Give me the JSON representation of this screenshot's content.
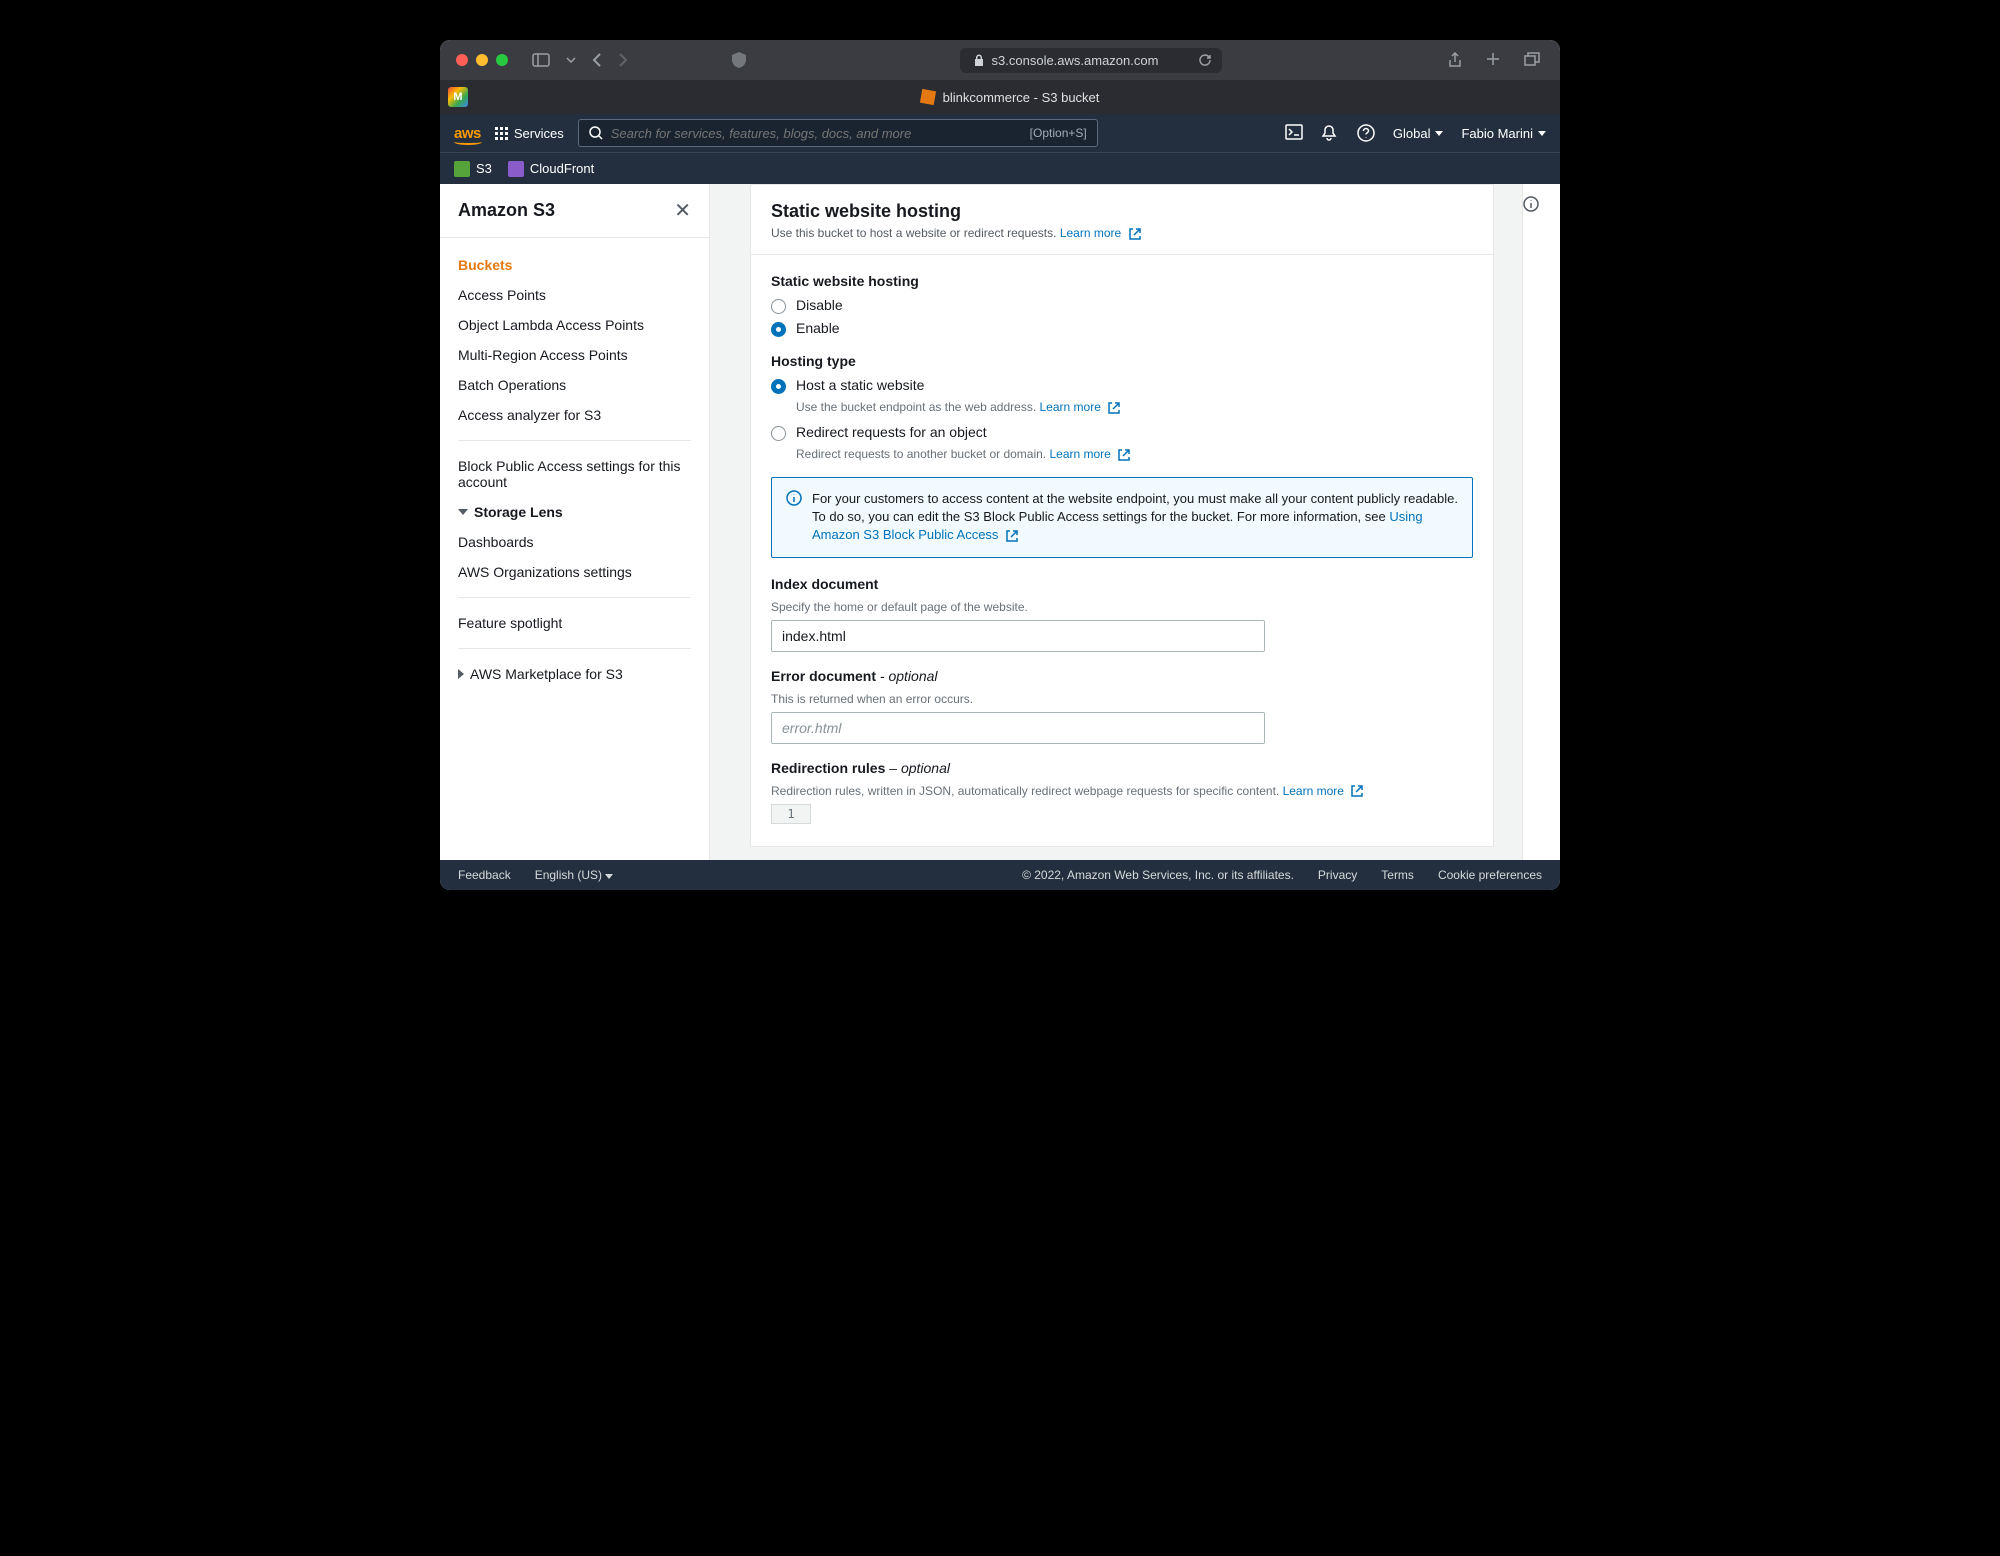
{
  "browser": {
    "url": "s3.console.aws.amazon.com",
    "tab_title": "blinkcommerce - S3 bucket"
  },
  "header": {
    "services": "Services",
    "search_placeholder": "Search for services, features, blogs, docs, and more",
    "search_hint": "[Option+S]",
    "region": "Global",
    "username": "Fabio Marini"
  },
  "sub_services": [
    "S3",
    "CloudFront"
  ],
  "sidebar": {
    "title": "Amazon S3",
    "items": [
      "Buckets",
      "Access Points",
      "Object Lambda Access Points",
      "Multi-Region Access Points",
      "Batch Operations",
      "Access analyzer for S3"
    ],
    "block_public": "Block Public Access settings for this account",
    "storage_lens": "Storage Lens",
    "lens_items": [
      "Dashboards",
      "AWS Organizations settings"
    ],
    "feature": "Feature spotlight",
    "marketplace": "AWS Marketplace for S3"
  },
  "panel": {
    "title": "Static website hosting",
    "subtitle": "Use this bucket to host a website or redirect requests.",
    "learn_more": "Learn more",
    "hosting_label": "Static website hosting",
    "disable": "Disable",
    "enable": "Enable",
    "hosting_type": "Hosting type",
    "host_static": "Host a static website",
    "host_static_desc": "Use the bucket endpoint as the web address.",
    "redirect": "Redirect requests for an object",
    "redirect_desc": "Redirect requests to another bucket or domain.",
    "info_text": "For your customers to access content at the website endpoint, you must make all your content publicly readable. To do so, you can edit the S3 Block Public Access settings for the bucket. For more information, see ",
    "info_link": "Using Amazon S3 Block Public Access",
    "index_label": "Index document",
    "index_desc": "Specify the home or default page of the website.",
    "index_value": "index.html",
    "error_label": "Error document",
    "error_optional": "- optional",
    "error_desc": "This is returned when an error occurs.",
    "error_placeholder": "error.html",
    "rules_label": "Redirection rules",
    "rules_optional": "– optional",
    "rules_desc": "Redirection rules, written in JSON, automatically redirect webpage requests for specific content."
  },
  "footer": {
    "feedback": "Feedback",
    "lang": "English (US)",
    "copyright": "© 2022, Amazon Web Services, Inc. or its affiliates.",
    "privacy": "Privacy",
    "terms": "Terms",
    "cookies": "Cookie preferences"
  }
}
